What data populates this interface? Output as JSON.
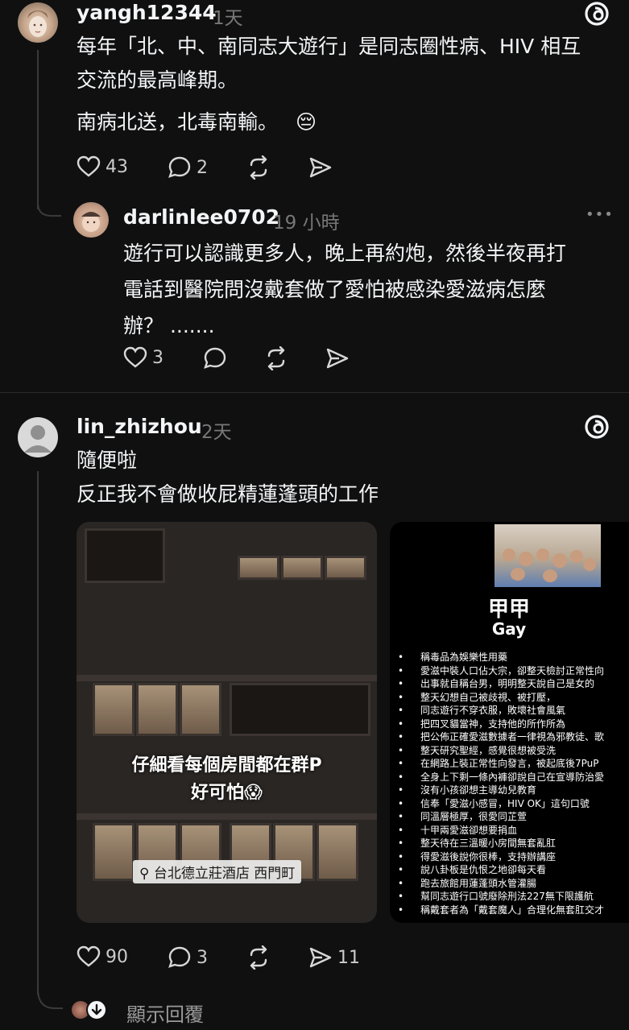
{
  "posts": [
    {
      "username": "yangh12344",
      "time": "1天",
      "text_lines": [
        "每年「北、中、南同志大遊行」是同志圈性病、HIV 相互",
        "交流的最高峰期。"
      ],
      "text_line2": "南病北送，北毒南輸。",
      "emoji": "😔",
      "likes": "43",
      "comments": "2",
      "avatar_icon": "bodhisattva-statue-avatar"
    },
    {
      "username": "darlinlee0702",
      "time": "19 小時",
      "text_lines": [
        "遊行可以認識更多人，晚上再約炮，然後半夜再打",
        "電話到醫院問沒戴套做了愛怕被感染愛滋病怎麼",
        "辦？ ......."
      ],
      "likes": "3",
      "more": "•••",
      "avatar_icon": "baby-photo-avatar"
    },
    {
      "username": "lin_zhizhou",
      "time": "2天",
      "text_lines": [
        "隨便啦",
        "反正我不會做收屁精蓮蓬頭的工作"
      ],
      "likes": "90",
      "comments": "3",
      "shares": "11",
      "avatar_icon": "default-user-avatar",
      "show_replies": "顯示回覆"
    }
  ],
  "media": {
    "photo_caption_lines": [
      "仔細看每個房間都在群P",
      "好可怕😱"
    ],
    "location": "台北德立莊酒店 西門町",
    "location_icon": "location-pin-icon",
    "infographic_title": "甲甲",
    "infographic_subtitle": "Gay",
    "infographic_items": [
      "稱毒品為娛樂性用藥",
      "愛滋中裝人口佔大宗，卻整天檢討正常性向",
      "出事就自稱台男，明明整天說自己是女的",
      "整天幻想自己被歧視、被打壓，",
      "同志遊行不穿衣服，敗壞社會風氣",
      "把四叉貓當神，支持他的所作所為",
      "把公佈正確愛滋數據者一律視為邪教徒、歌",
      "整天研究聖經，感覺很想被受洗",
      "在網路上裝正常性向發言，被起底後7PuP",
      "全身上下剩一條內褲卻說自己在宣導防治愛",
      "沒有小孩卻想主導幼兒教育",
      "信奉「愛滋小感冒，HIV OK」這句口號",
      "同溫層極厚，很愛同芷萱",
      "十甲兩愛滋卻想要捐血",
      "整天待在三溫暖小房間無套亂肛",
      "得愛滋後說你很棒，支持辦講座",
      "說八卦板是仇恨之地卻每天看",
      "跑去旅館用蓮蓬頭水管灌腸",
      "幫同志遊行口號廢除刑法227無下限護航",
      "稱戴套者為「戴套魔人」合理化無套肛交才"
    ]
  },
  "icons": {
    "threads": "threads-logo-icon",
    "like": "heart-icon",
    "comment": "comment-bubble-icon",
    "repost": "repost-icon",
    "share": "send-icon",
    "reply_avatar_arrow": "chevron-down-circle-icon"
  },
  "colors": {
    "background": "#101010",
    "text": "#f3f5f7",
    "muted": "#777777"
  }
}
